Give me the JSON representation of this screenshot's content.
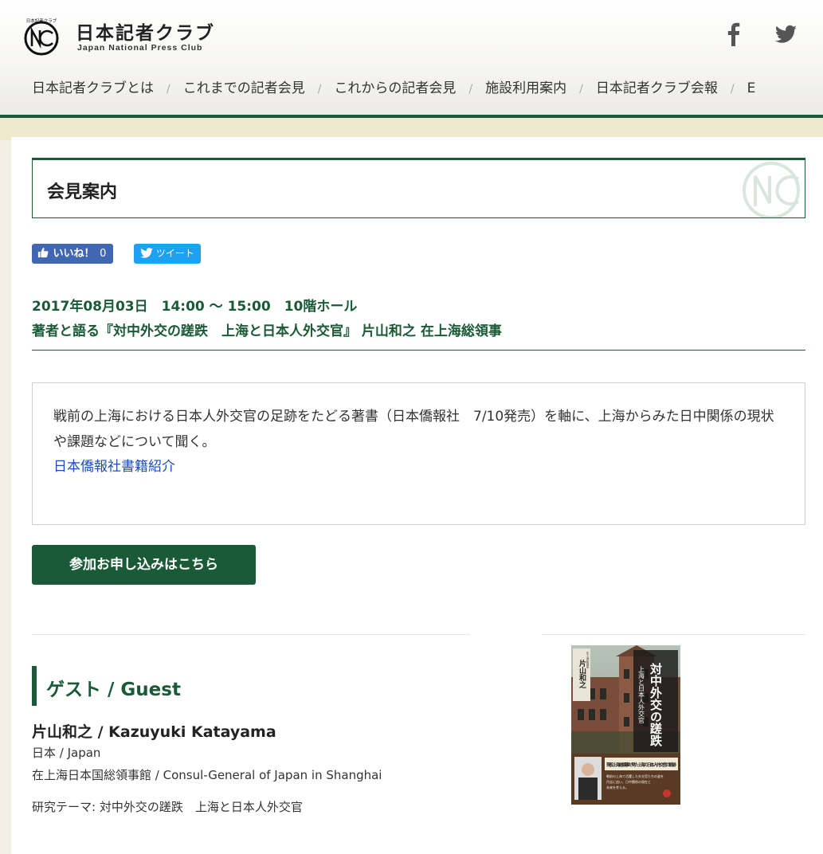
{
  "header": {
    "logo_title": "日本記者クラブ",
    "logo_subtitle": "Japan National Press Club",
    "logo_mark_text": "日本記者クラブ",
    "social": [
      {
        "name": "facebook",
        "icon": "facebook-icon"
      },
      {
        "name": "twitter",
        "icon": "twitter-icon"
      }
    ]
  },
  "nav": {
    "items": [
      "日本記者クラブとは",
      "これまでの記者会見",
      "これからの記者会見",
      "施設利用案内",
      "日本記者クラブ会報",
      "E"
    ],
    "separator": "/"
  },
  "page": {
    "title": "会見案内"
  },
  "share": {
    "like_label": "いいね！",
    "like_count": "0",
    "tweet_label": "ツイート"
  },
  "event": {
    "meta": "2017年08月03日　14:00 〜 15:00　10階ホール",
    "title": "著者と語る『対中外交の蹉跌　上海と日本人外交官』 片山和之 在上海総領事",
    "description": "戦前の上海における日本人外交官の足跡をたどる著書（日本僑報社　7/10発売）を軸に、上海からみた日中関係の現状や課題などについて聞く。",
    "link_label": "日本僑報社書籍紹介",
    "apply_label": "参加お申し込みはこちら"
  },
  "guest": {
    "heading": "ゲスト / Guest",
    "name": "片山和之 / Kazuyuki Katayama",
    "country": "日本 / Japan",
    "affiliation": "在上海日本国総領事館 / Consul-General of Japan in Shanghai",
    "theme": "研究テーマ: 対中外交の蹉跌　上海と日本人外交官"
  },
  "book": {
    "title": "対中外交の蹉跌",
    "subtitle": "上海と日本人外交官",
    "author": "片山和之",
    "series": "在上海総領事",
    "band_text": "現役上海総領事が見た上海の日本人外交官の軌跡",
    "blurb_lines": [
      "戦前の上海で活躍した外交官たちの姿を",
      "丹念に追い、日中関係の現在と",
      "未来を考える。"
    ]
  },
  "colors": {
    "brand_green": "#1b5a36",
    "link_blue": "#1a4fb4",
    "facebook_blue": "#4267b2",
    "twitter_blue": "#1da1f2",
    "page_beige": "#f3efe2"
  }
}
